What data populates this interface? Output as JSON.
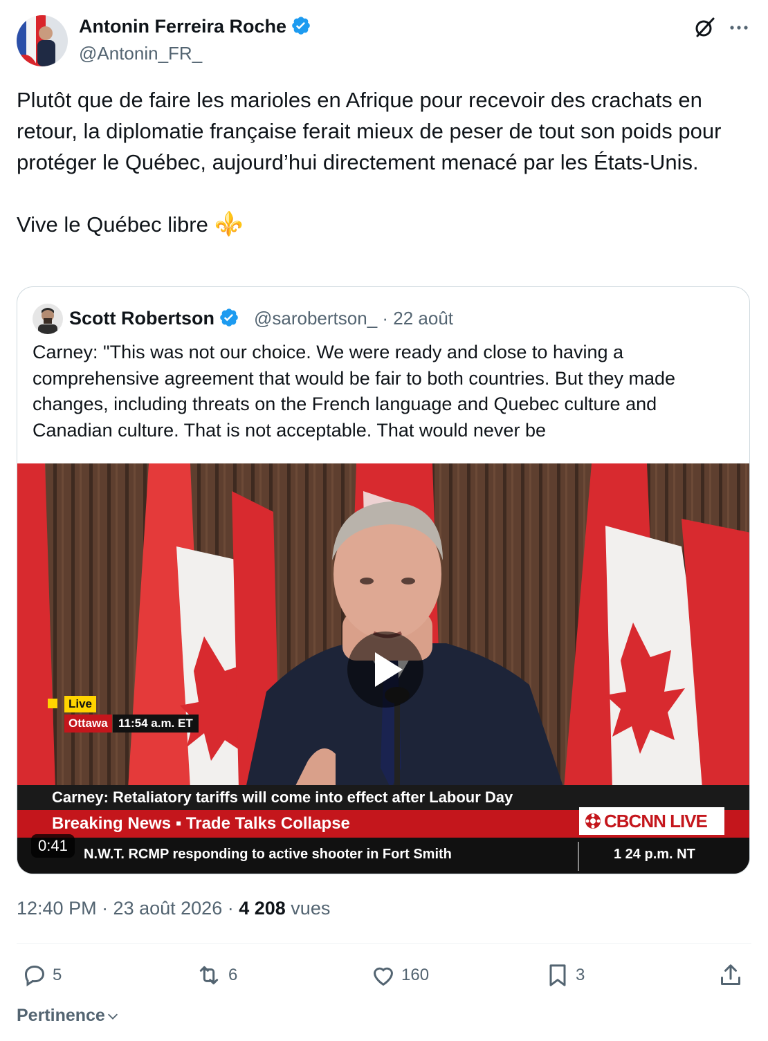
{
  "post": {
    "author_name": "Antonin Ferreira Roche",
    "author_handle": "@Antonin_FR_",
    "text_paragraph_1": "Plutôt que de faire les marioles en Afrique pour recevoir des crachats en retour, la diplomatie française ferait mieux de peser de tout son poids pour protéger le Québec, aujourd’hui directement menacé par les États-Unis.",
    "text_paragraph_2": "Vive le Québec libre",
    "emoji": "⚜️"
  },
  "quote": {
    "author_name": "Scott Robertson",
    "author_handle": "@sarobertson_",
    "date": "· 22 août",
    "text": "Carney: \"This was not our choice. We were ready and close to having a comprehensive agreement that would be fair to both countries. But they made changes, including threats on the French language and Quebec culture and Canadian culture. That is not acceptable. That would never be",
    "video": {
      "duration": "0:41",
      "live_label": "Live",
      "location": "Ottawa",
      "time": "11:54 a.m. ET",
      "headline": "Carney: Retaliatory tariffs will come into effect after Labour Day",
      "breaking": "Breaking News  ▪ Trade Talks Collapse",
      "network": "CBCNN LIVE",
      "news_ticker": "N.W.T. RCMP responding to active shooter in Fort Smith",
      "ticker_time": "1 24 p.m. NT"
    }
  },
  "meta": {
    "time": "12:40 PM · 23 août 2026 · ",
    "views_count": "4 208",
    "views_label": " vues"
  },
  "actions": {
    "replies": "5",
    "reposts": "6",
    "likes": "160",
    "bookmarks": "3"
  },
  "sort_label": "Pertinence",
  "colors": {
    "verified": "#1d9bf0",
    "text_primary": "#0f1419",
    "text_secondary": "#536471"
  }
}
